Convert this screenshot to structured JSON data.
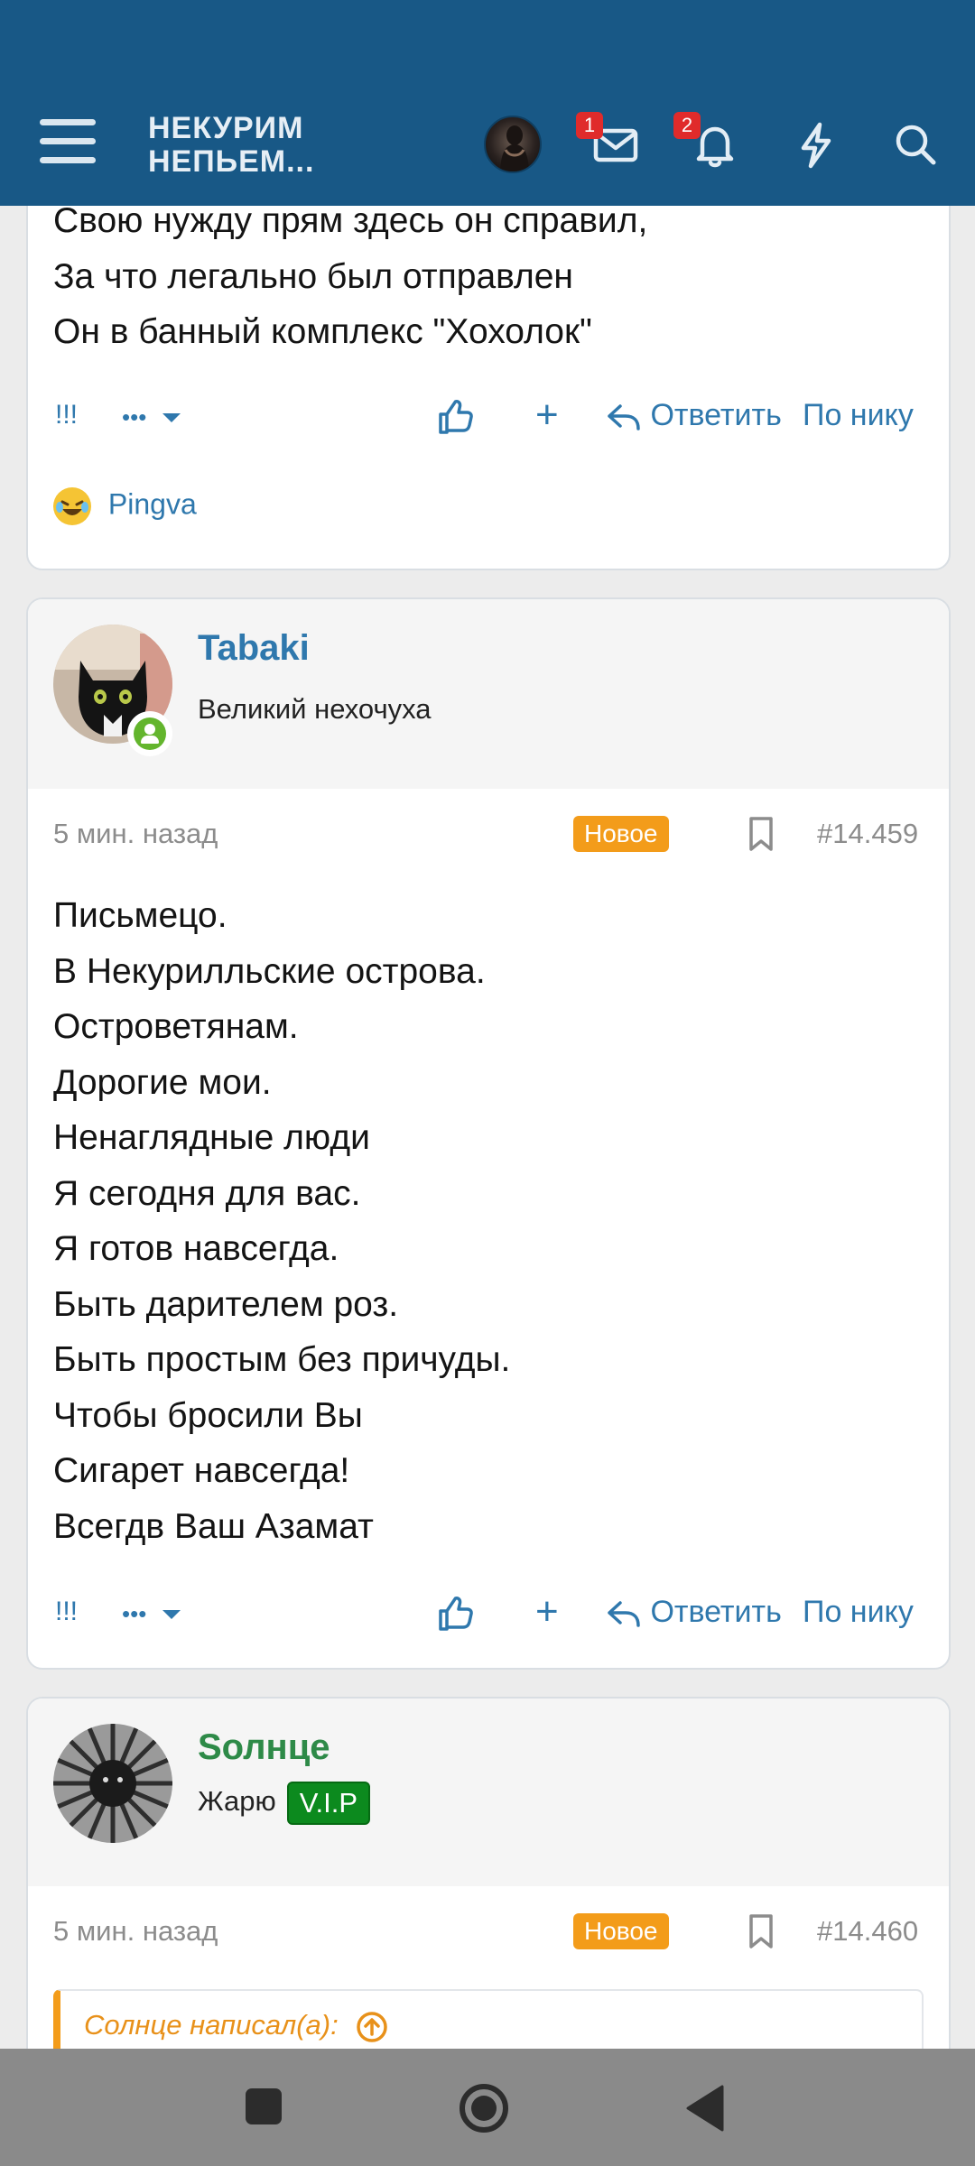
{
  "header": {
    "logo_line1": "НЕКУРИМ",
    "logo_line2": "НЕПЬЕМ...",
    "messages_badge": "1",
    "alerts_badge": "2",
    "bar_color": "#185886"
  },
  "prev_post": {
    "lines": [
      "Свою нужду прям здесь он справил,",
      "За что легально был отправлен",
      "Он в банный комплекс \"Хохолок\""
    ],
    "report": "!!!",
    "more": "•••",
    "plus": "+",
    "reply": "Ответить",
    "by_nick": "По нику",
    "reaction_user": "Pingva"
  },
  "post1": {
    "username": "Tabaki",
    "user_title": "Великий нехочуха",
    "time": "5 мин. назад",
    "new_label": "Новое",
    "number": "#14.459",
    "lines": [
      "Письмецо.",
      "В Некурилльские острова.",
      "Островетянам.",
      "Дорогие мои.",
      "Ненаглядные люди",
      "Я сегодня для вас.",
      "Я готов навсегда.",
      "Быть дарителем роз.",
      "Быть простым без причуды.",
      "Чтобы бросили Вы",
      "Сигарет навсегда!",
      "Всегдв Ваш Азамат"
    ],
    "report": "!!!",
    "more": "•••",
    "plus": "+",
    "reply": "Ответить",
    "by_nick": "По нику"
  },
  "post2": {
    "username": "Sолнце",
    "user_title": "Жарю",
    "vip": "V.I.P",
    "time": "5 мин. назад",
    "new_label": "Новое",
    "number": "#14.460",
    "quote_author": "Солнце написал(а):"
  },
  "colors": {
    "link": "#2f78ad",
    "username_blue": "#2f78ad",
    "username_green": "#2e8a48",
    "new_badge": "#f39c1a"
  }
}
